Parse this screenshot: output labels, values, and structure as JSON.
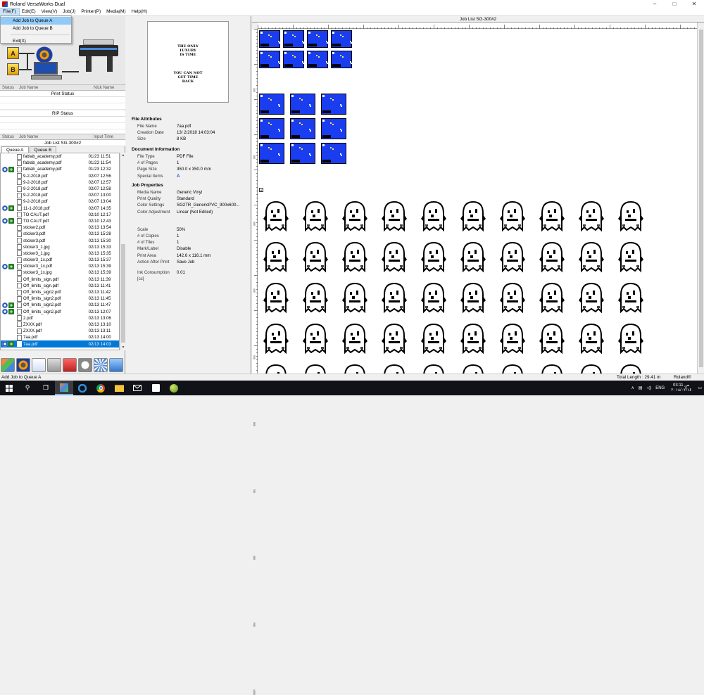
{
  "window": {
    "title": "Roland VersaWorks Dual",
    "minimize": "–",
    "maximize": "□",
    "close": "✕"
  },
  "menu": [
    "File(F)",
    "Edit(E)",
    "View(V)",
    "Job(J)",
    "Printer(P)",
    "Media(M)",
    "Help(H)"
  ],
  "file_menu": {
    "add_a": "Add Job to Queue A",
    "add_b": "Add Job to Queue B",
    "exit": "Exit(X)"
  },
  "queue_buttons": {
    "a": "A",
    "b": "B"
  },
  "print_status": {
    "col_status": "Status",
    "col_job": "Job Name",
    "col_nick": "Nick Name",
    "title": "Print Status"
  },
  "rip_status": {
    "title": "RIP Status"
  },
  "job_list": {
    "col_status": "Status",
    "col_job": "Job Name",
    "col_time": "Input Time",
    "title": "Job List SG-300#2",
    "tab_a": "Queue A",
    "tab_b": "Queue B",
    "rows": [
      {
        "name": "fablab_academy.pdf",
        "time": "01/23 11:51",
        "rip": false,
        "prt": false
      },
      {
        "name": "fablab_academy.pdf",
        "time": "01/23 11:54",
        "rip": false,
        "prt": false
      },
      {
        "name": "fablab_academy.pdf",
        "time": "01/23 12:32",
        "rip": true,
        "prt": true
      },
      {
        "name": "9-2-2018.pdf",
        "time": "02/07 12:56",
        "rip": false,
        "prt": false
      },
      {
        "name": "9-2-2018.pdf",
        "time": "02/07 12:57",
        "rip": false,
        "prt": false
      },
      {
        "name": "9-2-2018.pdf",
        "time": "02/07 12:58",
        "rip": false,
        "prt": false
      },
      {
        "name": "9-2-2018.pdf",
        "time": "02/07 13:00",
        "rip": false,
        "prt": false
      },
      {
        "name": "9-2-2018.pdf",
        "time": "02/07 13:04",
        "rip": false,
        "prt": false
      },
      {
        "name": "11-1-2018.pdf",
        "time": "02/07 14:35",
        "rip": true,
        "prt": true
      },
      {
        "name": "TO CAUT.pdf",
        "time": "02/10 12:17",
        "rip": false,
        "prt": false
      },
      {
        "name": "TO CAUT.pdf",
        "time": "02/10 12:43",
        "rip": true,
        "prt": true
      },
      {
        "name": "sticker2.pdf",
        "time": "02/13 13:54",
        "rip": false,
        "prt": false
      },
      {
        "name": "sticker3.pdf",
        "time": "02/13 15:28",
        "rip": false,
        "prt": false
      },
      {
        "name": "sticker3.pdf",
        "time": "02/13 15:30",
        "rip": false,
        "prt": false
      },
      {
        "name": "sticker3_1.jpg",
        "time": "02/13 15:33",
        "rip": false,
        "prt": false
      },
      {
        "name": "sticker3_1.jpg",
        "time": "02/13 15:35",
        "rip": false,
        "prt": false
      },
      {
        "name": "sticker3_1x.pdf",
        "time": "02/13 15:37",
        "rip": false,
        "prt": false
      },
      {
        "name": "sticker3_1x.pdf",
        "time": "02/13 15:39",
        "rip": true,
        "prt": true
      },
      {
        "name": "sticker3_1x.jpg",
        "time": "02/13 15:39",
        "rip": false,
        "prt": false
      },
      {
        "name": "Off_limits_sign.pdf",
        "time": "02/13 11:39",
        "rip": false,
        "prt": false
      },
      {
        "name": "Off_limits_sign.pdf",
        "time": "02/13 11:41",
        "rip": false,
        "prt": false
      },
      {
        "name": "Off_limits_sign2.pdf",
        "time": "02/13 11:42",
        "rip": false,
        "prt": false
      },
      {
        "name": "Off_limits_sign2.pdf",
        "time": "02/13 11:45",
        "rip": false,
        "prt": false
      },
      {
        "name": "Off_limits_sign2.pdf",
        "time": "02/13 11:47",
        "rip": true,
        "prt": true
      },
      {
        "name": "Off_limits_sign2.pdf",
        "time": "02/13 12:07",
        "rip": true,
        "prt": true
      },
      {
        "name": "2.pdf",
        "time": "02/13 13:06",
        "rip": false,
        "prt": false
      },
      {
        "name": "ZXXX.pdf",
        "time": "02/13 13:10",
        "rip": false,
        "prt": false
      },
      {
        "name": "ZXXX.pdf",
        "time": "02/13 13:11",
        "rip": false,
        "prt": false
      },
      {
        "name": "7aa.pdf",
        "time": "02/13 14:00",
        "rip": false,
        "prt": false
      },
      {
        "name": "7aa.pdf",
        "time": "02/13 14:03",
        "rip": true,
        "prt": true,
        "selected": true
      }
    ]
  },
  "preview_text": {
    "l1": "THE ONLY",
    "l2": "LUXURY",
    "l3": "IS TIME",
    "l4": "YOU CAN NOT",
    "l5": "GET TIME",
    "l6": "BACK"
  },
  "file_attributes": {
    "heading": "File Attributes",
    "k_name": "File Name",
    "v_name": "7aa.pdf",
    "k_date": "Creation Date",
    "v_date": "13/ 2/2018 14:03:04",
    "k_size": "Size",
    "v_size": "8 KB"
  },
  "document_info": {
    "heading": "Document Information",
    "k_type": "File Type",
    "v_type": "PDF File",
    "k_pages": "# of Pages",
    "v_pages": "1",
    "k_psize": "Page Size",
    "v_psize": "350.0 x 350.0 mm",
    "k_special": "Special Items",
    "v_special": "A"
  },
  "job_properties": {
    "heading": "Job Properties",
    "k_media": "Media Name",
    "v_media": "Generic Vinyl",
    "k_quality": "Print Quality",
    "v_quality": "Standard",
    "k_color": "Color Settings",
    "v_color": "SG2TR_GenericPVC_900x600...",
    "k_adjust": "Color Adjustment",
    "v_adjust": "Linear (Not Edited)",
    "k_scale": "Scale",
    "v_scale": "50%",
    "k_copies": "# of Copies",
    "v_copies": "1",
    "k_tiles": "# of Tiles",
    "v_tiles": "1",
    "k_mark": "Mark/Label",
    "v_mark": "Disable",
    "k_area": "Print Area",
    "v_area": "142.6 x 116.1 mm",
    "k_action": "Action After Print",
    "v_action": "Save Job",
    "k_ink": "Ink Consumption [cc]",
    "v_ink": "0.01"
  },
  "right_panel": {
    "title": "Job List SG-300#2",
    "groups": [
      "B",
      "B",
      "A"
    ]
  },
  "ruler_labels": [
    "100",
    "200",
    "300",
    "400",
    "500",
    "600",
    "700",
    "800",
    "900",
    "1000"
  ],
  "statusbar": {
    "left": "Add Job to Queue A",
    "length": "Total Length : 29.41 m",
    "brand": "Roland®"
  },
  "taskbar": {
    "search": "⚲",
    "taskview": "❐",
    "lang": "ENG",
    "time": "03:11 ص",
    "date": "٢٠١٨/٠٢/١٤"
  },
  "colors": {
    "accent": "#0078d7",
    "tile": "#1a3df0",
    "menu_highlight": "#91c9f7"
  }
}
